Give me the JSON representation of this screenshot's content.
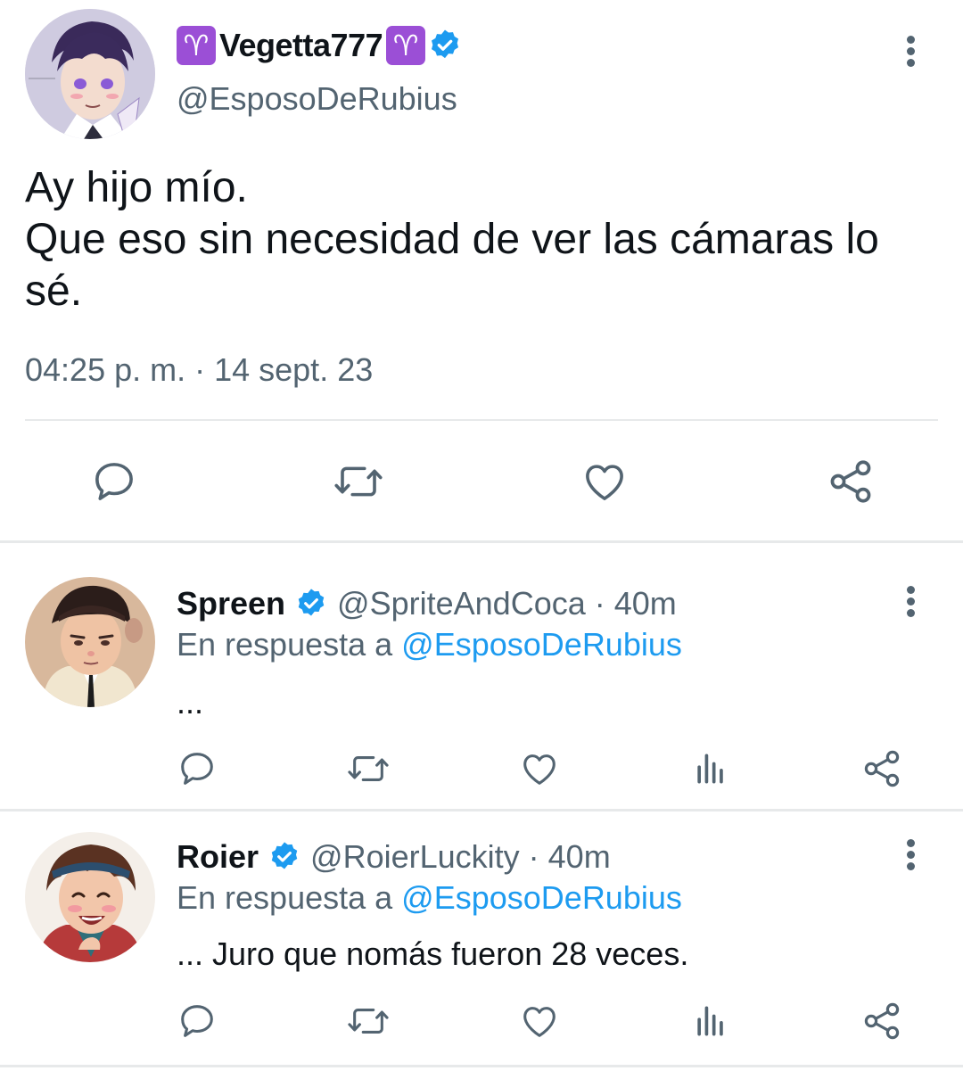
{
  "main_tweet": {
    "display_name_prefix_emoji": "♈",
    "display_name": "Vegetta777",
    "display_name_suffix_emoji": "♈",
    "handle": "@EsposoDeRubius",
    "text_lines": [
      "Ay hijo mío.",
      "Que eso sin necesidad de ver las cámaras lo sé."
    ],
    "timestamp": "04:25 p. m. · 14 sept. 23",
    "actions": [
      "reply-icon",
      "retweet-icon",
      "like-icon",
      "share-icon"
    ]
  },
  "replies": [
    {
      "display_name": "Spreen",
      "handle": "@SpriteAndCoca",
      "time": "· 40m",
      "reply_to_label": "En respuesta a",
      "reply_to_handle": "@EsposoDeRubius",
      "text": "...",
      "actions": [
        "reply-icon",
        "retweet-icon",
        "like-icon",
        "analytics-icon",
        "share-icon"
      ]
    },
    {
      "display_name": "Roier",
      "handle": "@RoierLuckity",
      "time": "· 40m",
      "reply_to_label": "En respuesta a",
      "reply_to_handle": "@EsposoDeRubius",
      "text": "... Juro que nomás fueron 28 veces.",
      "actions": [
        "reply-icon",
        "retweet-icon",
        "like-icon",
        "analytics-icon",
        "share-icon"
      ]
    }
  ],
  "colors": {
    "text_primary": "#0f1419",
    "text_secondary": "#536471",
    "link": "#1d9bf0",
    "verified": "#1d9bf0",
    "aries_badge": "#9b4fd6",
    "divider": "#e7e9ea"
  }
}
